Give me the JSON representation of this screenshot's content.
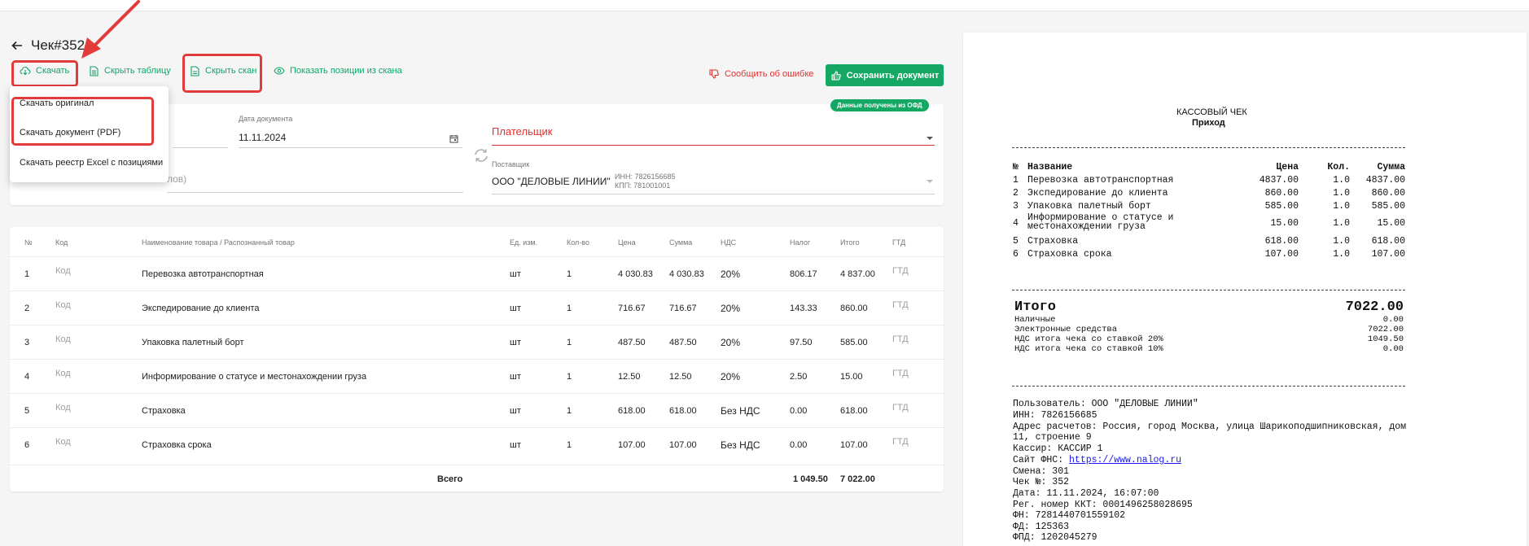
{
  "title": "Чек#352",
  "toolbar": {
    "download": "Скачать",
    "hide_table": "Скрыть таблицу",
    "hide_scan": "Скрыть скан",
    "show_positions": "Показать позиции из скана",
    "report_error": "Сообщить об ошибке",
    "save_document": "Сохранить документ"
  },
  "dropdown": {
    "items": [
      "Скачать оригинал",
      "Скачать документ (PDF)",
      "Скачать реестр Excel с позициями"
    ]
  },
  "form": {
    "doc_date_label": "Дата документа",
    "doc_date": "11.11.2024",
    "payer_label": "Плательщик",
    "supplier_label": "Поставщик",
    "supplier_value": "ООО \"ДЕЛОВЫЕ ЛИНИИ\"",
    "supplier_inn": "ИНН: 7826156685",
    "supplier_kpp": "КПП: 781001001",
    "partial_text": "лов)",
    "ofd_badge": "Данные получены из ОФД"
  },
  "table": {
    "headers": [
      "№",
      "Код",
      "Наименование товара / Распознанный товар",
      "Ед. изм.",
      "Кол-во",
      "Цена",
      "Сумма",
      "НДС",
      "Налог",
      "Итого",
      "ГТД"
    ],
    "rows": [
      {
        "n": "1",
        "code": "Код",
        "name": "Перевозка автотранспортная",
        "unit": "шт",
        "qty": "1",
        "price": "4 030.83",
        "sum": "4 030.83",
        "vat": "20%",
        "tax": "806.17",
        "total": "4 837.00",
        "gtd": "ГТД"
      },
      {
        "n": "2",
        "code": "Код",
        "name": "Экспедирование до клиента",
        "unit": "шт",
        "qty": "1",
        "price": "716.67",
        "sum": "716.67",
        "vat": "20%",
        "tax": "143.33",
        "total": "860.00",
        "gtd": "ГТД"
      },
      {
        "n": "3",
        "code": "Код",
        "name": "Упаковка палетный борт",
        "unit": "шт",
        "qty": "1",
        "price": "487.50",
        "sum": "487.50",
        "vat": "20%",
        "tax": "97.50",
        "total": "585.00",
        "gtd": "ГТД"
      },
      {
        "n": "4",
        "code": "Код",
        "name": "Информирование о статусе и местонахождении груза",
        "unit": "шт",
        "qty": "1",
        "price": "12.50",
        "sum": "12.50",
        "vat": "20%",
        "tax": "2.50",
        "total": "15.00",
        "gtd": "ГТД"
      },
      {
        "n": "5",
        "code": "Код",
        "name": "Страховка",
        "unit": "шт",
        "qty": "1",
        "price": "618.00",
        "sum": "618.00",
        "vat": "Без НДС",
        "tax": "0.00",
        "total": "618.00",
        "gtd": "ГТД"
      },
      {
        "n": "6",
        "code": "Код",
        "name": "Страховка срока",
        "unit": "шт",
        "qty": "1",
        "price": "107.00",
        "sum": "107.00",
        "vat": "Без НДС",
        "tax": "0.00",
        "total": "107.00",
        "gtd": "ГТД"
      }
    ],
    "totals": {
      "label": "Всего",
      "tax": "1 049.50",
      "total": "7 022.00"
    }
  },
  "receipt": {
    "title": "КАССОВЫЙ ЧЕК",
    "subtitle": "Приход",
    "headers": [
      "№",
      "Название",
      "Цена",
      "Кол.",
      "Сумма"
    ],
    "items": [
      {
        "n": "1",
        "name": "Перевозка автотранспортная",
        "name2": "",
        "price": "4837.00",
        "qty": "1.0",
        "sum": "4837.00"
      },
      {
        "n": "2",
        "name": "Экспедирование до клиента",
        "name2": "",
        "price": "860.00",
        "qty": "1.0",
        "sum": "860.00"
      },
      {
        "n": "3",
        "name": "Упаковка палетный борт",
        "name2": "",
        "price": "585.00",
        "qty": "1.0",
        "sum": "585.00"
      },
      {
        "n": "4",
        "name": "Информирование о статусе и",
        "name2": "местонахождении груза",
        "price": "15.00",
        "qty": "1.0",
        "sum": "15.00"
      },
      {
        "n": "5",
        "name": "Страховка",
        "name2": "",
        "price": "618.00",
        "qty": "1.0",
        "sum": "618.00"
      },
      {
        "n": "6",
        "name": "Страховка срока",
        "name2": "",
        "price": "107.00",
        "qty": "1.0",
        "sum": "107.00"
      }
    ],
    "total_label": "Итого",
    "total_value": "7022.00",
    "summary": [
      {
        "label": "Наличные",
        "value": "0.00"
      },
      {
        "label": "Электронные средства",
        "value": "7022.00"
      },
      {
        "label": "НДС итога чека со ставкой 20%",
        "value": "1049.50"
      },
      {
        "label": "НДС итога чека со ставкой 10%",
        "value": "0.00"
      }
    ],
    "info": {
      "user": "Пользователь: ООО \"ДЕЛОВЫЕ ЛИНИИ\"",
      "inn": "ИНН: 7826156685",
      "address1": "Адрес расчетов: Россия, город Москва, улица Шарикоподшипниковская, дом",
      "address2": "11, строение 9",
      "cashier": "Кассир: КАССИР 1",
      "fns_label": "Сайт ФНС: ",
      "fns_link": "https://www.nalog.ru",
      "shift": "Смена: 301",
      "check_no": "Чек №: 352",
      "date": "Дата: 11.11.2024, 16:07:00",
      "reg": "Рег. номер ККТ: 0001496258028695",
      "fn": "ФН: 7281440701559102",
      "fd": "ФД: 125363",
      "fpd": "ФПД: 1202045279"
    }
  },
  "colors": {
    "accent": "#14a864",
    "link": "#0ea567",
    "error": "#e03030",
    "highlight": "#e23b3b"
  }
}
